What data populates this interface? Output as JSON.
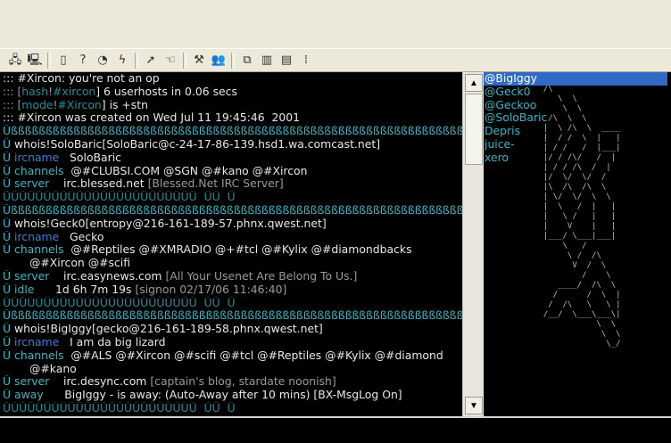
{
  "toolbar": {
    "groups": [
      [
        {
          "name": "connect-icon",
          "glyph": "🖧"
        },
        {
          "name": "disconnect-icon",
          "glyph": "🖳"
        }
      ],
      [
        {
          "name": "open-icon",
          "glyph": "▯"
        },
        {
          "name": "help-icon",
          "glyph": "?"
        },
        {
          "name": "query-icon",
          "glyph": "◔"
        },
        {
          "name": "lightning-icon",
          "glyph": "ϟ"
        }
      ],
      [
        {
          "name": "run-icon",
          "glyph": "➚"
        },
        {
          "name": "hand-icon",
          "glyph": "☜"
        }
      ],
      [
        {
          "name": "tools-icon",
          "glyph": "⚒"
        },
        {
          "name": "users-icon",
          "glyph": "👥"
        }
      ],
      [
        {
          "name": "cascade-window-icon",
          "glyph": "⧉"
        },
        {
          "name": "tile-vertical-icon",
          "glyph": "▥"
        },
        {
          "name": "tile-horizontal-icon",
          "glyph": "▤"
        },
        {
          "name": "arrange-icon",
          "glyph": "⁞"
        }
      ]
    ]
  },
  "chat": {
    "lines": [
      {
        "indent": false,
        "segments": [
          {
            "t": "::: #Xircon: you're not an op",
            "c": "c-white"
          }
        ]
      },
      {
        "indent": false,
        "segments": [
          {
            "t": "::: [",
            "c": "c-grey"
          },
          {
            "t": "hash",
            "c": "c-teal"
          },
          {
            "t": "!",
            "c": "c-grey"
          },
          {
            "t": "#xircon",
            "c": "c-teal"
          },
          {
            "t": "] 6 userhosts in 0.06 secs",
            "c": "c-white"
          }
        ]
      },
      {
        "indent": false,
        "segments": [
          {
            "t": "::: [",
            "c": "c-grey"
          },
          {
            "t": "mode",
            "c": "c-teal"
          },
          {
            "t": "!",
            "c": "c-grey"
          },
          {
            "t": "#Xircon",
            "c": "c-teal"
          },
          {
            "t": "] is +stn",
            "c": "c-white"
          }
        ]
      },
      {
        "indent": false,
        "segments": [
          {
            "t": "::: #Xircon was created on Wed Jul 11 19:45:46  2001",
            "c": "c-white"
          }
        ]
      },
      {
        "indent": false,
        "segments": [
          {
            "t": "Ûßßßßßßßßßßßßßßßßßßßßßßßßßßßßßßßßßßßßßßßßßßßßßßßßßßßßßßßßßßßßßßßßßßßßßßßßßßßßßßßßßßßßßßßßßßßßßßßßßßßßßß",
            "c": "c-cyan"
          }
        ]
      },
      {
        "indent": false,
        "segments": [
          {
            "t": "Û ",
            "c": "c-cyan"
          },
          {
            "t": "whois!SoloBaric[SoloBaric@c-24-17-86-139.hsd1.wa.comcast.net]",
            "c": "c-white"
          }
        ]
      },
      {
        "indent": false,
        "segments": [
          {
            "t": "Û ",
            "c": "c-cyan"
          },
          {
            "t": "ircname",
            "c": "c-blue"
          },
          {
            "t": "   SoloBaric",
            "c": "c-white"
          }
        ]
      },
      {
        "indent": false,
        "segments": [
          {
            "t": "Û ",
            "c": "c-cyan"
          },
          {
            "t": "channels",
            "c": "c-cyan"
          },
          {
            "t": "  @#CLUBSI.COM @SGN @#kano @#Xircon",
            "c": "c-white"
          }
        ]
      },
      {
        "indent": false,
        "segments": [
          {
            "t": "Û ",
            "c": "c-cyan"
          },
          {
            "t": "server",
            "c": "c-cyan"
          },
          {
            "t": "    irc.blessed.net ",
            "c": "c-white"
          },
          {
            "t": "[Blessed.Net IRC Server]",
            "c": "c-grey"
          }
        ]
      },
      {
        "indent": false,
        "segments": [
          {
            "t": "ÛÛÛÛÛÛÛÛÛÛÛÛÛÛÛÛÛÛÛÛÛÛÛÛ  ÛÛ  Û",
            "c": "c-teal"
          }
        ]
      },
      {
        "indent": false,
        "segments": [
          {
            "t": "Ûßßßßßßßßßßßßßßßßßßßßßßßßßßßßßßßßßßßßßßßßßßßßßßßßßßßßßßßßßßßßßßßßßßßßßßßßßßßßßßßßßßßßßßßßßßßßßßßßßßßßßß",
            "c": "c-cyan"
          }
        ]
      },
      {
        "indent": false,
        "segments": [
          {
            "t": "Û ",
            "c": "c-cyan"
          },
          {
            "t": "whois!Geck0[entropy@216-161-189-57.phnx.qwest.net]",
            "c": "c-white"
          }
        ]
      },
      {
        "indent": false,
        "segments": [
          {
            "t": "Û ",
            "c": "c-cyan"
          },
          {
            "t": "ircname",
            "c": "c-blue"
          },
          {
            "t": "   Gecko",
            "c": "c-white"
          }
        ]
      },
      {
        "indent": false,
        "segments": [
          {
            "t": "Û ",
            "c": "c-cyan"
          },
          {
            "t": "channels",
            "c": "c-cyan"
          },
          {
            "t": "  @#Reptiles @#XMRADIO @+#tcl @#Kylix @#diamondbacks",
            "c": "c-white"
          }
        ]
      },
      {
        "indent": true,
        "segments": [
          {
            "t": "@#Xircon @#scifi",
            "c": "c-white"
          }
        ]
      },
      {
        "indent": false,
        "segments": [
          {
            "t": "Û ",
            "c": "c-cyan"
          },
          {
            "t": "server",
            "c": "c-cyan"
          },
          {
            "t": "    irc.easynews.com ",
            "c": "c-white"
          },
          {
            "t": "[All Your Usenet Are Belong To Us.]",
            "c": "c-grey"
          }
        ]
      },
      {
        "indent": false,
        "segments": [
          {
            "t": "Û ",
            "c": "c-cyan"
          },
          {
            "t": "idle",
            "c": "c-cyan"
          },
          {
            "t": "      1d 6h 7m 19s ",
            "c": "c-white"
          },
          {
            "t": "[signon 02/17/06 11:46:40]",
            "c": "c-grey"
          }
        ]
      },
      {
        "indent": false,
        "segments": [
          {
            "t": "ÛÛÛÛÛÛÛÛÛÛÛÛÛÛÛÛÛÛÛÛÛÛÛÛ  ÛÛ  Û",
            "c": "c-teal"
          }
        ]
      },
      {
        "indent": false,
        "segments": [
          {
            "t": "Ûßßßßßßßßßßßßßßßßßßßßßßßßßßßßßßßßßßßßßßßßßßßßßßßßßßßßßßßßßßßßßßßßßßßßßßßßßßßßßßßßßßßßßßßßßßßßßßßßßßßßßß",
            "c": "c-cyan"
          }
        ]
      },
      {
        "indent": false,
        "segments": [
          {
            "t": "Û ",
            "c": "c-cyan"
          },
          {
            "t": "whois!BigIggy[gecko@216-161-189-58.phnx.qwest.net]",
            "c": "c-white"
          }
        ]
      },
      {
        "indent": false,
        "segments": [
          {
            "t": "Û ",
            "c": "c-cyan"
          },
          {
            "t": "ircname",
            "c": "c-blue"
          },
          {
            "t": "   I am da big lizard",
            "c": "c-white"
          }
        ]
      },
      {
        "indent": false,
        "segments": [
          {
            "t": "Û ",
            "c": "c-cyan"
          },
          {
            "t": "channels",
            "c": "c-cyan"
          },
          {
            "t": "  @#ALS @#Xircon @#scifi @#tcl @#Reptiles @#Kylix @#diamond",
            "c": "c-white"
          }
        ]
      },
      {
        "indent": true,
        "segments": [
          {
            "t": "@#kano",
            "c": "c-white"
          }
        ]
      },
      {
        "indent": false,
        "segments": [
          {
            "t": "Û ",
            "c": "c-cyan"
          },
          {
            "t": "server",
            "c": "c-cyan"
          },
          {
            "t": "    irc.desync.com ",
            "c": "c-white"
          },
          {
            "t": "[captain's blog, stardate noonish]",
            "c": "c-grey"
          }
        ]
      },
      {
        "indent": false,
        "segments": [
          {
            "t": "Û ",
            "c": "c-cyan"
          },
          {
            "t": "away",
            "c": "c-cyan"
          },
          {
            "t": "      BigIggy - is away: (Auto-Away after 10 mins) [BX-MsgLog On]",
            "c": "c-white"
          }
        ]
      },
      {
        "indent": false,
        "segments": [
          {
            "t": "ÛÛÛÛÛÛÛÛÛÛÛÛÛÛÛÛÛÛÛÛÛÛÛÛ  ÛÛ  Û",
            "c": "c-teal"
          }
        ]
      }
    ]
  },
  "nicklist": {
    "items": [
      "@BigIggy",
      "@Geck0",
      "@Geckoo",
      "@SoloBaric",
      "Depris",
      "juice-",
      "xero"
    ],
    "selected_index": 0,
    "background_art": "  /\\     \n     \\  \\ \n      \\  \\    \n   /\\  \\  \\ \n  |  \\ /\\  \\  ____\n  |  / /  \\  |   |\n  | / /   /  |___|\n  |/ / /\\/   /  |\n  | / / /\\  /  |\n  |/  \\/  \\/  / \n  |\\  /\\  /\\  \\ \n  | \\/  \\/  \\  \\\n  |  \\   /  |   |\n  |   \\ /   |   |\n  |    V    |   |\n  |___/ \\___|___|\n      \\   /    \n       \\ /  /\\ \n        V  /  \\\n          /    \\\n     ____/  /\\  \\\n    /      /  \\  |\n   /  /\\   \\   \\ |\n  /__/  \\___\\___\\|\n             \\  \\\n              \\  \\\n               \\_/"
  },
  "colors": {
    "chat_bg": "#000000",
    "selected_nick_bg": "#316ac5",
    "nick_color": "#2fb8c8",
    "chrome_bg": "#ece9d8"
  }
}
